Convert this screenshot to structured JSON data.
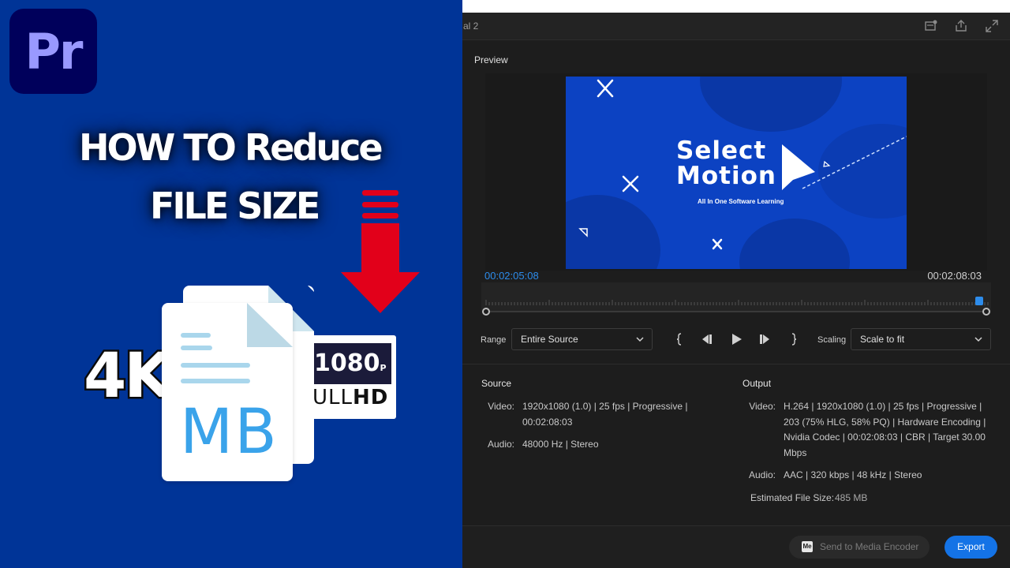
{
  "thumbnail": {
    "app_logo_text": "Pr",
    "headline_line1": "HOW TO Reduce",
    "headline_line2": "FILE SIZE",
    "badge_4k": "4K",
    "hd_resolution": "1080",
    "hd_resolution_suffix": "P",
    "hd_full_part1": "ULL",
    "hd_full_part2": "HD",
    "file_icon_text": "MB",
    "colors": {
      "background": "#003497",
      "arrow": "#e2001a",
      "logo_bg": "#00005b",
      "logo_text": "#9999ff",
      "mb_text": "#3aa3ea"
    }
  },
  "window": {
    "tab_title": "al 2",
    "icons": [
      "new-bin-icon",
      "share-icon",
      "fullscreen-icon"
    ]
  },
  "preview": {
    "label": "Preview",
    "video_title_line1": "Select",
    "video_title_line2": "Motion",
    "video_subtitle": "All In One Software Learning",
    "timecode_current": "00:02:05:08",
    "timecode_duration": "00:02:08:03",
    "playhead_fraction": 0.98
  },
  "controls": {
    "range_label": "Range",
    "range_value": "Entire Source",
    "scaling_label": "Scaling",
    "scaling_value": "Scale to fit",
    "transport_icons": [
      "mark-in-icon",
      "step-back-icon",
      "play-icon",
      "step-forward-icon",
      "mark-out-icon"
    ]
  },
  "source": {
    "title": "Source",
    "video_label": "Video:",
    "video_lines": [
      "1920x1080 (1.0) | 25 fps | Progressive |",
      "00:02:08:03"
    ],
    "audio_label": "Audio:",
    "audio_value": "48000 Hz | Stereo"
  },
  "output": {
    "title": "Output",
    "video_label": "Video:",
    "video_lines": [
      "H.264 | 1920x1080 (1.0) | 25 fps | Progressive |",
      "203 (75% HLG, 58% PQ) | Hardware Encoding |",
      "Nvidia Codec | 00:02:08:03 | CBR | Target 30.00",
      "Mbps"
    ],
    "audio_label": "Audio:",
    "audio_value": "AAC | 320 kbps | 48 kHz | Stereo",
    "file_size_label": "Estimated File Size:",
    "file_size_value": "485 MB"
  },
  "footer": {
    "media_encoder_badge": "Me",
    "media_encoder_label": "Send to Media Encoder",
    "export_label": "Export",
    "accent": "#1473e6"
  }
}
